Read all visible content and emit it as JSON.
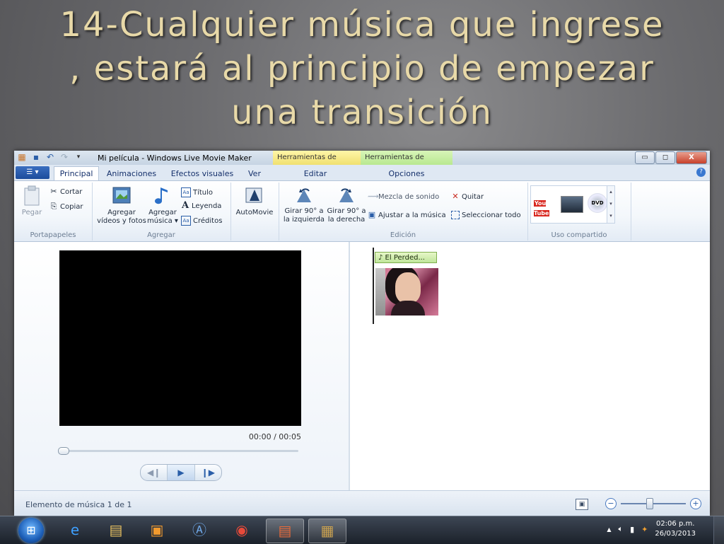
{
  "slide": {
    "title_line1": "14-Cualquier música que ingrese",
    "title_line2": ", estará al principio de empezar",
    "title_line3": "una transición"
  },
  "window": {
    "title": "Mi película - Windows Live Movie Maker",
    "context_video": "Herramientas de vídeo",
    "context_music": "Herramientas de música",
    "controls": {
      "minimize": "▭",
      "maximize": "◻",
      "close": "X"
    }
  },
  "tabs": [
    {
      "label": "Principal",
      "active": true
    },
    {
      "label": "Animaciones"
    },
    {
      "label": "Efectos visuales"
    },
    {
      "label": "Ver"
    },
    {
      "label": "Editar"
    },
    {
      "label": "Opciones"
    }
  ],
  "ribbon": {
    "portapapeles": {
      "label": "Portapapeles",
      "pegar": "Pegar",
      "cortar": "Cortar",
      "copiar": "Copiar"
    },
    "agregar": {
      "label": "Agregar",
      "videos_line1": "Agregar",
      "videos_line2": "vídeos y fotos",
      "musica_line1": "Agregar",
      "musica_line2": "música ▾",
      "titulo": "Título",
      "leyenda": "Leyenda",
      "creditos": "Créditos"
    },
    "automovie": "AutoMovie",
    "edicion": {
      "label": "Edición",
      "girar_izq_line1": "Girar 90° a",
      "girar_izq_line2": "la izquierda",
      "girar_der_line1": "Girar 90° a",
      "girar_der_line2": "la derecha",
      "mezcla": "Mezcla de sonido",
      "quitar": "Quitar",
      "ajustar": "Ajustar a la música",
      "seleccionar": "Seleccionar todo"
    },
    "uso_compartido": {
      "label": "Uso compartido",
      "youtube": "You Tube",
      "dvd": "DVD"
    }
  },
  "preview": {
    "timecode": "00:00 / 00:05",
    "progress": 0
  },
  "storyboard": {
    "music_clip": "♪ El Perded..."
  },
  "status": {
    "text": "Elemento de música 1 de 1",
    "zoom_minus": "−",
    "zoom_plus": "+"
  },
  "taskbar": {
    "time": "02:06 p.m.",
    "date": "26/03/2013"
  },
  "colors": {
    "title_text": "#e8d9a8",
    "accent": "#2a5ea8",
    "music_clip": "#bfe59a"
  }
}
